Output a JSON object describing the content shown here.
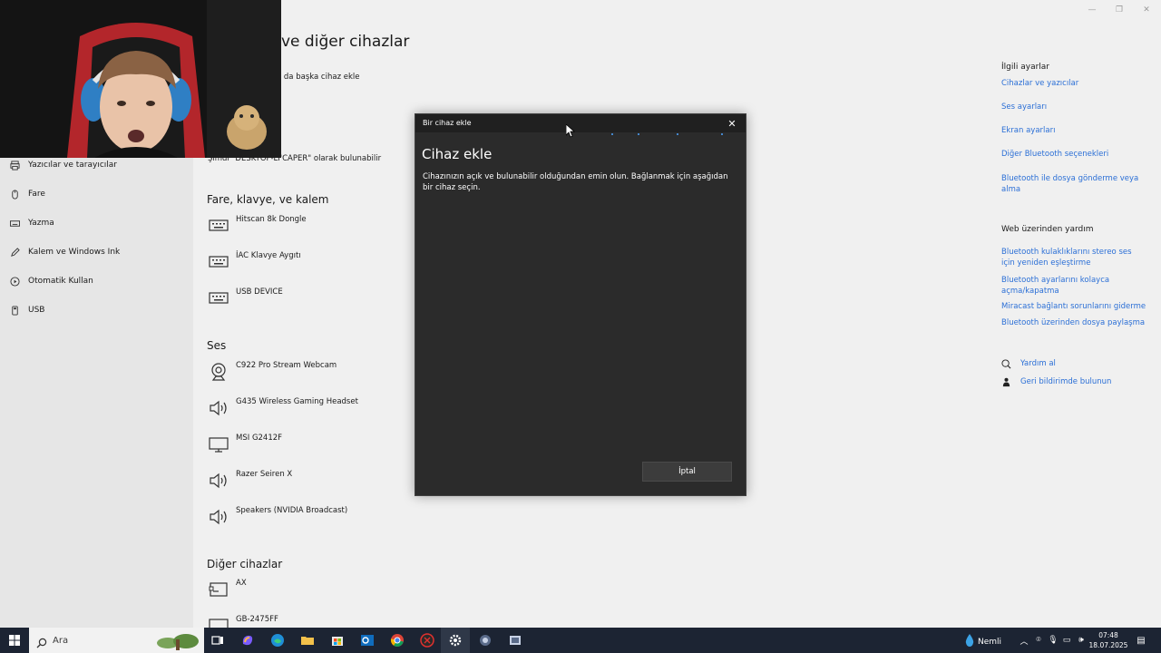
{
  "settings": {
    "page_title": "ve diğer cihazlar",
    "add_device_text": "a da başka cihaz ekle",
    "discoverable_text": "Şimdi \"DESKTOP-LI'CAPER\" olarak bulunabilir",
    "sidebar": [
      {
        "label": "Yazıcılar ve tarayıcılar",
        "icon": "printer-icon"
      },
      {
        "label": "Fare",
        "icon": "mouse-icon"
      },
      {
        "label": "Yazma",
        "icon": "keyboard-icon"
      },
      {
        "label": "Kalem ve Windows Ink",
        "icon": "pen-icon"
      },
      {
        "label": "Otomatik Kullan",
        "icon": "autoplay-icon"
      },
      {
        "label": "USB",
        "icon": "usb-icon"
      }
    ],
    "sections": {
      "mouse_keyboard_pen": {
        "title": "Fare, klavye, ve kalem",
        "devices": [
          "Hitscan 8k Dongle",
          "İAC Klavye Aygıtı",
          "USB DEVICE"
        ]
      },
      "audio": {
        "title": "Ses",
        "devices": [
          "C922 Pro Stream Webcam",
          "G435 Wireless Gaming Headset",
          "MSI G2412F",
          "Razer Seiren X",
          "Speakers (NVIDIA Broadcast)"
        ]
      },
      "other": {
        "title": "Diğer cihazlar",
        "devices": [
          "AX",
          "GB-2475FF"
        ]
      }
    },
    "related": {
      "heading": "İlgili ayarlar",
      "links": [
        "Cihazlar ve yazıcılar",
        "Ses ayarları",
        "Ekran ayarları",
        "Diğer Bluetooth seçenekleri",
        "Bluetooth ile dosya gönderme veya alma"
      ]
    },
    "web_help": {
      "heading": "Web üzerinden yardım",
      "links": [
        "Bluetooth kulaklıklarını stereo ses için yeniden eşleştirme",
        "Bluetooth ayarlarını kolayca açma/kapatma",
        "Miracast bağlantı sorunlarını giderme",
        "Bluetooth üzerinden dosya paylaşma"
      ]
    },
    "help": {
      "get_help": "Yardım al",
      "feedback": "Geri bildirimde bulunun"
    }
  },
  "dialog": {
    "window_title": "Bir cihaz ekle",
    "heading": "Cihaz ekle",
    "description": "Cihazınızın açık ve bulunabilir olduğundan emin olun. Bağlanmak için aşağıdan bir cihaz seçin.",
    "cancel_label": "İptal"
  },
  "taskbar": {
    "search_placeholder": "Ara",
    "weather_text": "Nemli",
    "time": "07:48",
    "date": "18.07.2025"
  },
  "colors": {
    "accent_link": "#2b6fd6",
    "dialog_bg": "#2b2b2b",
    "taskbar_bg": "#1c2433"
  }
}
